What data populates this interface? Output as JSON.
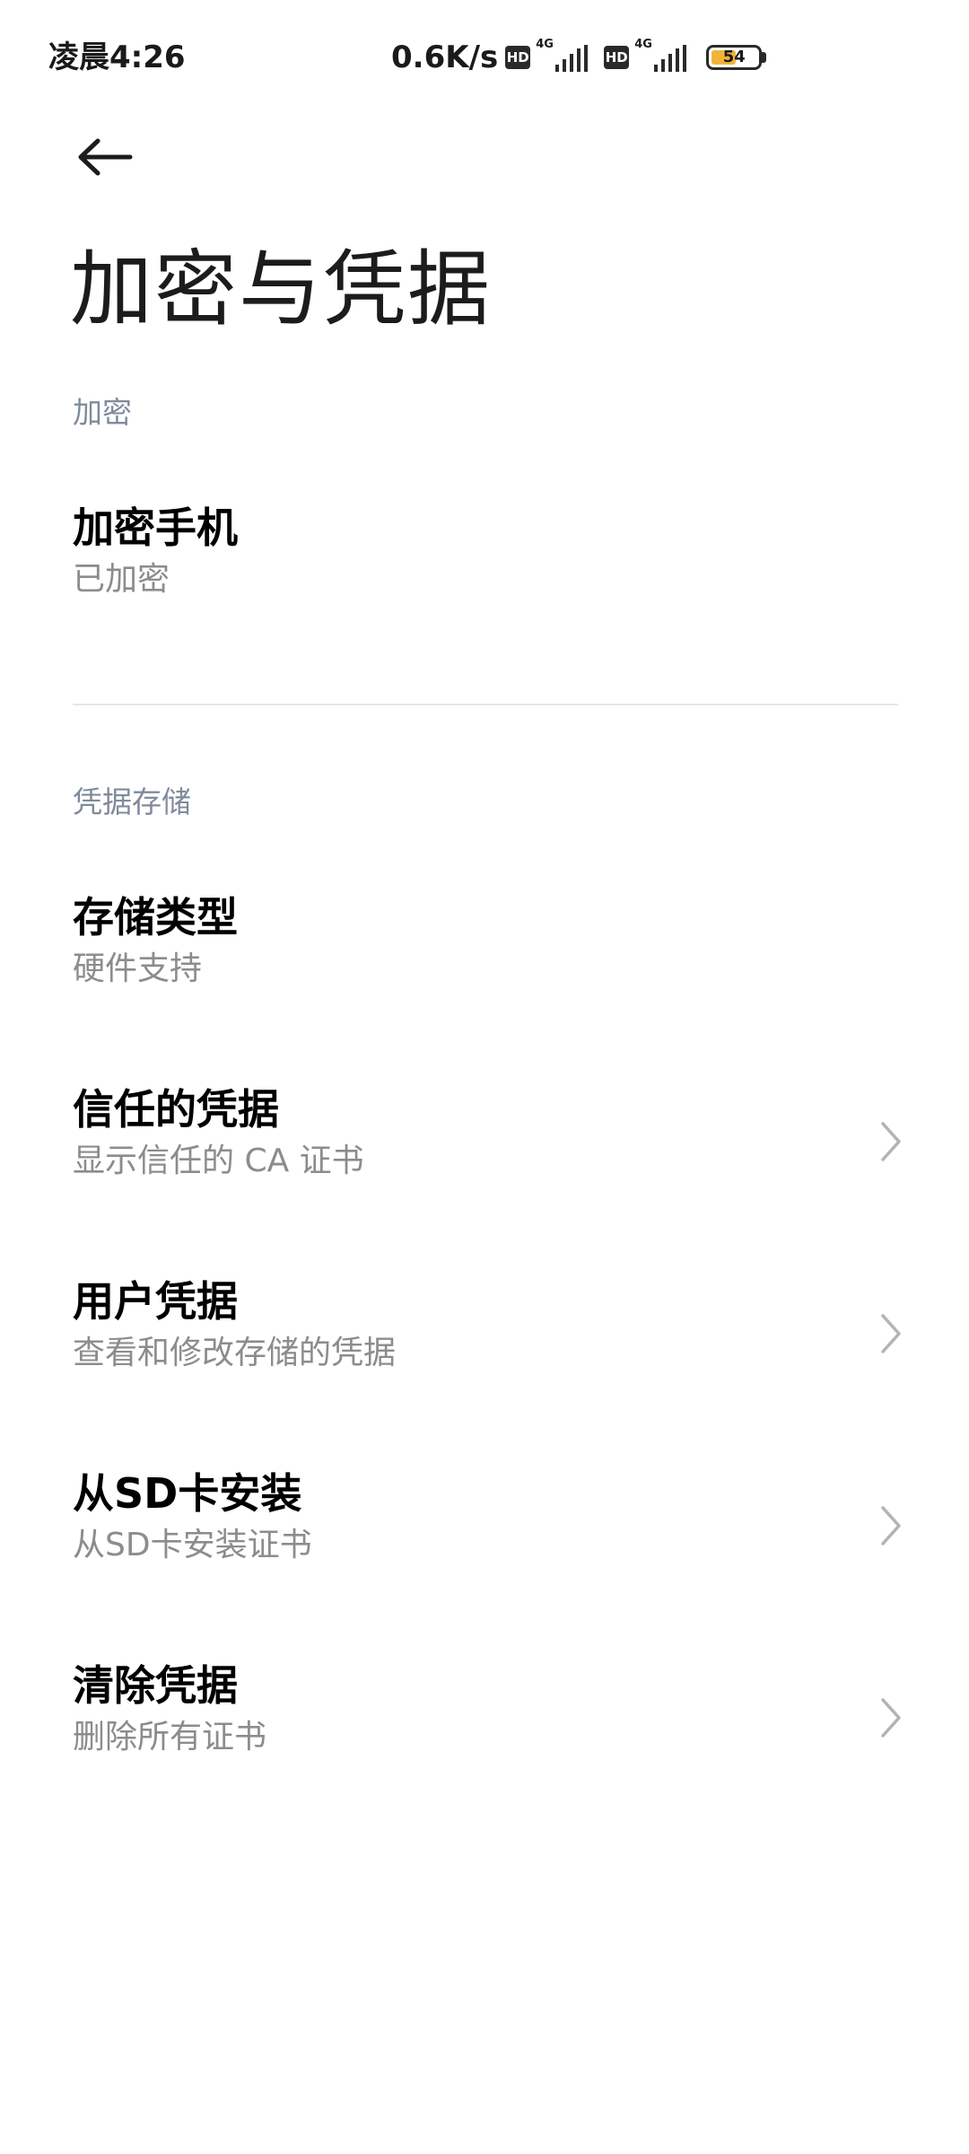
{
  "status_bar": {
    "time": "凌晨4:26",
    "speed": "0.6K/s",
    "hd_label": "HD",
    "net_label": "4G",
    "battery": "54",
    "battery_level": 0.54,
    "battery_fill_color": "#f2b339"
  },
  "header": {
    "back_icon": "arrow-left-icon",
    "title": "加密与凭据"
  },
  "sections": {
    "encryption": {
      "header": "加密",
      "items": [
        {
          "title": "加密手机",
          "summary": "已加密",
          "has_chevron": false
        }
      ]
    },
    "credentials": {
      "header": "凭据存储",
      "items": [
        {
          "title": "存储类型",
          "summary": "硬件支持",
          "has_chevron": false
        },
        {
          "title": "信任的凭据",
          "summary": "显示信任的 CA 证书",
          "has_chevron": true
        },
        {
          "title": "用户凭据",
          "summary": "查看和修改存储的凭据",
          "has_chevron": true
        },
        {
          "title": "从SD卡安装",
          "summary": "从SD卡安装证书",
          "has_chevron": true
        },
        {
          "title": "清除凭据",
          "summary": "删除所有证书",
          "has_chevron": true
        }
      ]
    }
  },
  "colors": {
    "section_header": "#7f8b9b",
    "summary": "#8c8c8c",
    "chevron": "#b3b3b3",
    "divider": "#e6e6e6"
  }
}
